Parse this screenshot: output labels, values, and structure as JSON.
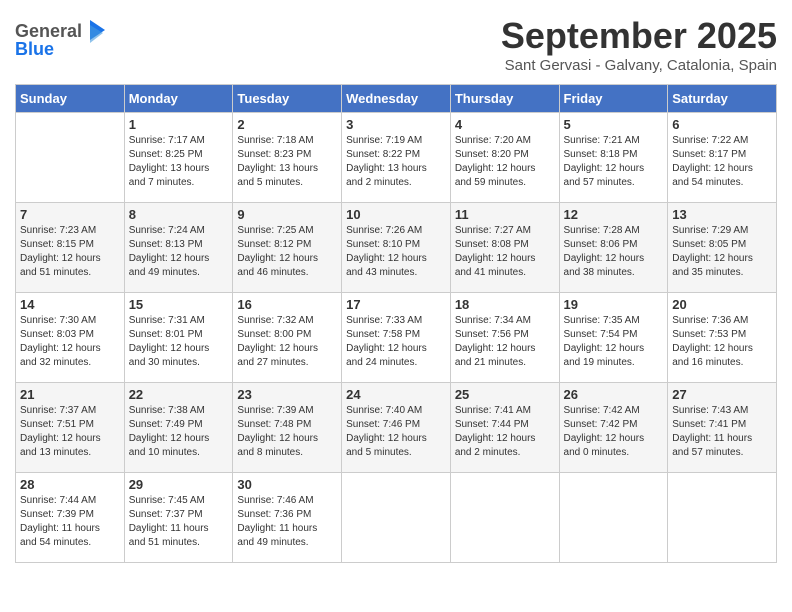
{
  "logo": {
    "general": "General",
    "blue": "Blue"
  },
  "title": "September 2025",
  "subtitle": "Sant Gervasi - Galvany, Catalonia, Spain",
  "columns": [
    "Sunday",
    "Monday",
    "Tuesday",
    "Wednesday",
    "Thursday",
    "Friday",
    "Saturday"
  ],
  "weeks": [
    [
      {
        "day": "",
        "info": ""
      },
      {
        "day": "1",
        "info": "Sunrise: 7:17 AM\nSunset: 8:25 PM\nDaylight: 13 hours\nand 7 minutes."
      },
      {
        "day": "2",
        "info": "Sunrise: 7:18 AM\nSunset: 8:23 PM\nDaylight: 13 hours\nand 5 minutes."
      },
      {
        "day": "3",
        "info": "Sunrise: 7:19 AM\nSunset: 8:22 PM\nDaylight: 13 hours\nand 2 minutes."
      },
      {
        "day": "4",
        "info": "Sunrise: 7:20 AM\nSunset: 8:20 PM\nDaylight: 12 hours\nand 59 minutes."
      },
      {
        "day": "5",
        "info": "Sunrise: 7:21 AM\nSunset: 8:18 PM\nDaylight: 12 hours\nand 57 minutes."
      },
      {
        "day": "6",
        "info": "Sunrise: 7:22 AM\nSunset: 8:17 PM\nDaylight: 12 hours\nand 54 minutes."
      }
    ],
    [
      {
        "day": "7",
        "info": "Sunrise: 7:23 AM\nSunset: 8:15 PM\nDaylight: 12 hours\nand 51 minutes."
      },
      {
        "day": "8",
        "info": "Sunrise: 7:24 AM\nSunset: 8:13 PM\nDaylight: 12 hours\nand 49 minutes."
      },
      {
        "day": "9",
        "info": "Sunrise: 7:25 AM\nSunset: 8:12 PM\nDaylight: 12 hours\nand 46 minutes."
      },
      {
        "day": "10",
        "info": "Sunrise: 7:26 AM\nSunset: 8:10 PM\nDaylight: 12 hours\nand 43 minutes."
      },
      {
        "day": "11",
        "info": "Sunrise: 7:27 AM\nSunset: 8:08 PM\nDaylight: 12 hours\nand 41 minutes."
      },
      {
        "day": "12",
        "info": "Sunrise: 7:28 AM\nSunset: 8:06 PM\nDaylight: 12 hours\nand 38 minutes."
      },
      {
        "day": "13",
        "info": "Sunrise: 7:29 AM\nSunset: 8:05 PM\nDaylight: 12 hours\nand 35 minutes."
      }
    ],
    [
      {
        "day": "14",
        "info": "Sunrise: 7:30 AM\nSunset: 8:03 PM\nDaylight: 12 hours\nand 32 minutes."
      },
      {
        "day": "15",
        "info": "Sunrise: 7:31 AM\nSunset: 8:01 PM\nDaylight: 12 hours\nand 30 minutes."
      },
      {
        "day": "16",
        "info": "Sunrise: 7:32 AM\nSunset: 8:00 PM\nDaylight: 12 hours\nand 27 minutes."
      },
      {
        "day": "17",
        "info": "Sunrise: 7:33 AM\nSunset: 7:58 PM\nDaylight: 12 hours\nand 24 minutes."
      },
      {
        "day": "18",
        "info": "Sunrise: 7:34 AM\nSunset: 7:56 PM\nDaylight: 12 hours\nand 21 minutes."
      },
      {
        "day": "19",
        "info": "Sunrise: 7:35 AM\nSunset: 7:54 PM\nDaylight: 12 hours\nand 19 minutes."
      },
      {
        "day": "20",
        "info": "Sunrise: 7:36 AM\nSunset: 7:53 PM\nDaylight: 12 hours\nand 16 minutes."
      }
    ],
    [
      {
        "day": "21",
        "info": "Sunrise: 7:37 AM\nSunset: 7:51 PM\nDaylight: 12 hours\nand 13 minutes."
      },
      {
        "day": "22",
        "info": "Sunrise: 7:38 AM\nSunset: 7:49 PM\nDaylight: 12 hours\nand 10 minutes."
      },
      {
        "day": "23",
        "info": "Sunrise: 7:39 AM\nSunset: 7:48 PM\nDaylight: 12 hours\nand 8 minutes."
      },
      {
        "day": "24",
        "info": "Sunrise: 7:40 AM\nSunset: 7:46 PM\nDaylight: 12 hours\nand 5 minutes."
      },
      {
        "day": "25",
        "info": "Sunrise: 7:41 AM\nSunset: 7:44 PM\nDaylight: 12 hours\nand 2 minutes."
      },
      {
        "day": "26",
        "info": "Sunrise: 7:42 AM\nSunset: 7:42 PM\nDaylight: 12 hours\nand 0 minutes."
      },
      {
        "day": "27",
        "info": "Sunrise: 7:43 AM\nSunset: 7:41 PM\nDaylight: 11 hours\nand 57 minutes."
      }
    ],
    [
      {
        "day": "28",
        "info": "Sunrise: 7:44 AM\nSunset: 7:39 PM\nDaylight: 11 hours\nand 54 minutes."
      },
      {
        "day": "29",
        "info": "Sunrise: 7:45 AM\nSunset: 7:37 PM\nDaylight: 11 hours\nand 51 minutes."
      },
      {
        "day": "30",
        "info": "Sunrise: 7:46 AM\nSunset: 7:36 PM\nDaylight: 11 hours\nand 49 minutes."
      },
      {
        "day": "",
        "info": ""
      },
      {
        "day": "",
        "info": ""
      },
      {
        "day": "",
        "info": ""
      },
      {
        "day": "",
        "info": ""
      }
    ]
  ]
}
